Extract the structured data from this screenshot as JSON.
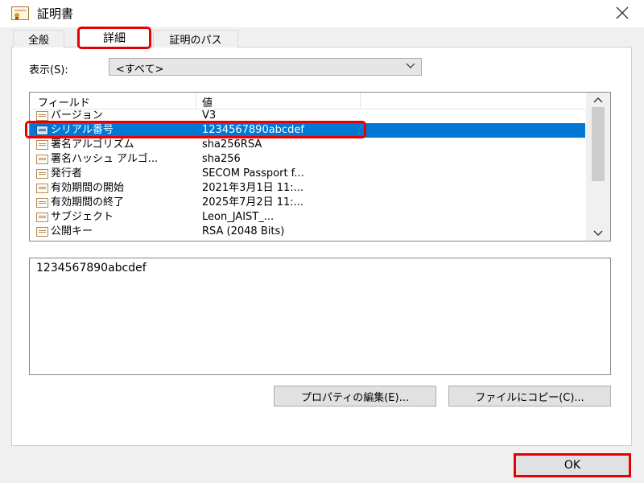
{
  "window": {
    "title": "証明書"
  },
  "tabs": [
    "全般",
    "詳細",
    "証明のパス"
  ],
  "show": {
    "label": "表示(S):",
    "selected": "<すべて>"
  },
  "list": {
    "headers": {
      "field": "フィールド",
      "value": "値"
    },
    "rows": [
      {
        "field": "バージョン",
        "value": "V3"
      },
      {
        "field": "シリアル番号",
        "value": "1234567890abcdef",
        "selected": true
      },
      {
        "field": "署名アルゴリズム",
        "value": "sha256RSA"
      },
      {
        "field": "署名ハッシュ アルゴ...",
        "value": "sha256"
      },
      {
        "field": "発行者",
        "value": "SECOM Passport f..."
      },
      {
        "field": "有効期間の開始",
        "value": "2021年3月1日 11:..."
      },
      {
        "field": "有効期間の終了",
        "value": "2025年7月2日 11:..."
      },
      {
        "field": "サブジェクト",
        "value": "Leon_JAIST_..."
      },
      {
        "field": "公開キー",
        "value": "RSA (2048 Bits)"
      }
    ]
  },
  "detail": {
    "text": "1234567890abcdef"
  },
  "buttons": {
    "edit": "プロパティの編集(E)...",
    "copy": "ファイルにコピー(C)...",
    "ok": "OK"
  },
  "icons": {
    "title": "certificate-icon",
    "close": "close-icon",
    "field": "field-icon",
    "dropdown": "chevron-down-icon"
  },
  "colors": {
    "selection": "#0078d7",
    "annotation": "#e60000"
  }
}
